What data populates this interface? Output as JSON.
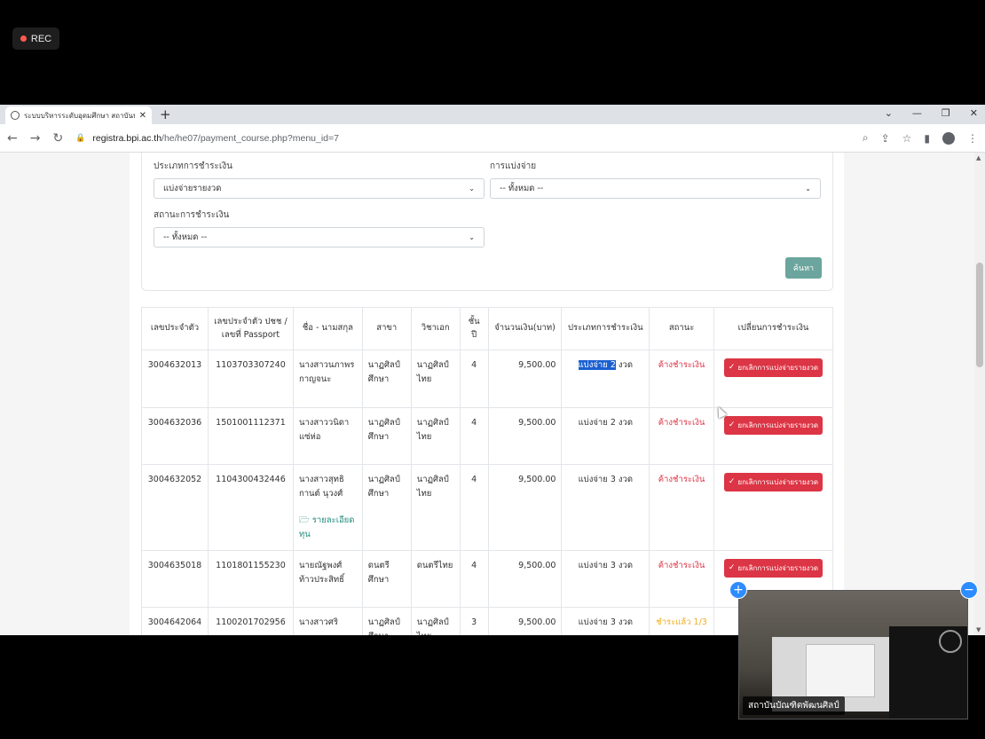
{
  "recording": {
    "label": "REC"
  },
  "browser": {
    "tab_title": "ระบบบริหารระดับอุดมศึกษา สถาบันบัณฑิต",
    "url_host": "registra.bpi.ac.th",
    "url_path": "/he/he07/payment_course.php?menu_id=7"
  },
  "filters": {
    "payment_type_label": "ประเภทการชำระเงิน",
    "payment_type_value": "แบ่งจ่ายรายงวด",
    "installment_label": "การแบ่งจ่าย",
    "installment_value": "-- ทั้งหมด --",
    "status_label": "สถานะการชำระเงิน",
    "status_value": "-- ทั้งหมด --",
    "search_label": "ค้นหา"
  },
  "table": {
    "headers": [
      "เลขประจำตัว",
      "เลขประจำตัว ปชช / เลขที่ Passport",
      "ชื่อ - นามสกุล",
      "สาขา",
      "วิชาเอก",
      "ชั้นปี",
      "จำนวนเงิน(บาท)",
      "ประเภทการชำระเงิน",
      "สถานะ",
      "เปลี่ยนการชำระเงิน"
    ],
    "rows": [
      {
        "student_id": "3004632013",
        "national_id": "1103703307240",
        "name": "นางสาวนภาพร กาญจนะ",
        "branch": "นาฏศิลป์ศึกษา",
        "major": "นาฏศิลป์ไทย",
        "year": "4",
        "amount": "9,500.00",
        "payment_type_hl": "แบ่งจ่าย 2",
        "payment_type_rest": " งวด",
        "status": "ค้างชำระเงิน",
        "action": "ยกเลิกการแบ่งจ่ายรายงวด"
      },
      {
        "student_id": "3004632036",
        "national_id": "1501001112371",
        "name": "นางสาววนิดา แซ่ห่อ",
        "branch": "นาฏศิลป์ศึกษา",
        "major": "นาฏศิลป์ไทย",
        "year": "4",
        "amount": "9,500.00",
        "payment_type": "แบ่งจ่าย 2 งวด",
        "status": "ค้างชำระเงิน",
        "action": "ยกเลิกการแบ่งจ่ายรายงวด"
      },
      {
        "student_id": "3004632052",
        "national_id": "1104300432446",
        "name": "นางสาวสุทธิกานต์ นุวงศ์",
        "detail_link": "รายละเอียดทุน",
        "branch": "นาฏศิลป์ศึกษา",
        "major": "นาฏศิลป์ไทย",
        "year": "4",
        "amount": "9,500.00",
        "payment_type": "แบ่งจ่าย 3 งวด",
        "status": "ค้างชำระเงิน",
        "action": "ยกเลิกการแบ่งจ่ายรายงวด"
      },
      {
        "student_id": "3004635018",
        "national_id": "1101801155230",
        "name": "นายณัฐพงศ์ ท้าวประสิทธิ์",
        "branch": "ดนตรีศึกษา",
        "major": "ดนตรีไทย",
        "year": "4",
        "amount": "9,500.00",
        "payment_type": "แบ่งจ่าย 3 งวด",
        "status": "ค้างชำระเงิน",
        "action": "ยกเลิกการแบ่งจ่ายรายงวด"
      },
      {
        "student_id": "3004642064",
        "national_id": "1100201702956",
        "name": "นางสาวศริ",
        "branch": "นาฏศิลป์ศึกษา",
        "major": "นาฏศิลป์ไทย",
        "year": "3",
        "amount": "9,500.00",
        "payment_type": "แบ่งจ่าย 3 งวด",
        "status": "ชำระแล้ว 1/3"
      }
    ]
  },
  "video": {
    "caption": "สถาบันบัณฑิตพัฒนศิลป์"
  },
  "colors": {
    "danger": "#dc3545",
    "warning": "#f0ad1e",
    "search_button": "#6ba59d",
    "link": "#1e8a7a",
    "highlight": "#1a5fd1"
  }
}
